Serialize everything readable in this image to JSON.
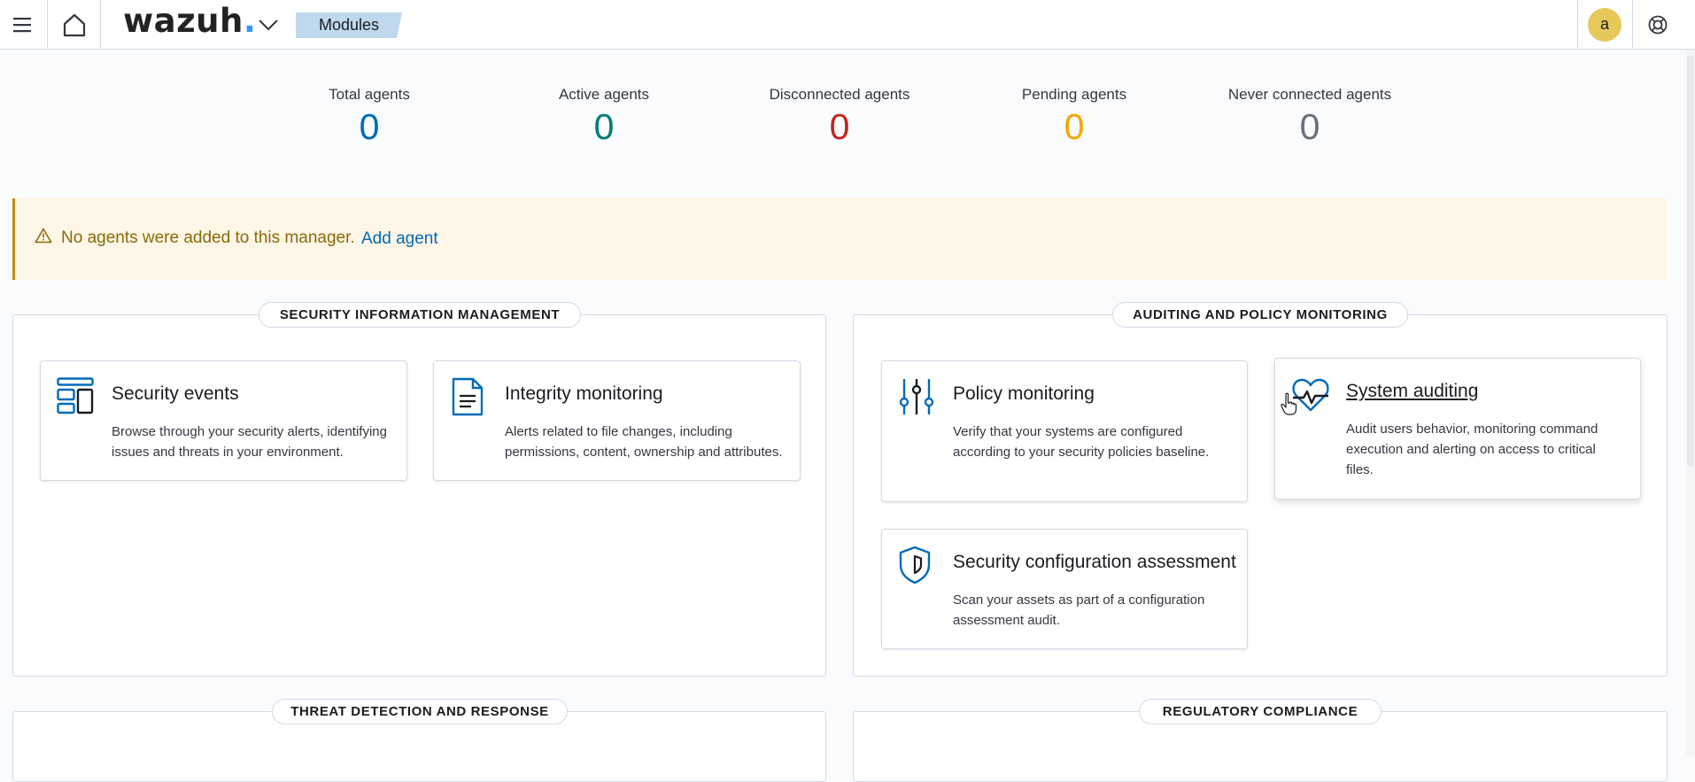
{
  "header": {
    "logo_text": "wazuh",
    "logo_dot": ".",
    "breadcrumb": "Modules",
    "user_initial": "a",
    "accent": "#3595f9"
  },
  "stats": [
    {
      "label": "Total agents",
      "value": "0",
      "color": "#006bb8"
    },
    {
      "label": "Active agents",
      "value": "0",
      "color": "#017d73"
    },
    {
      "label": "Disconnected agents",
      "value": "0",
      "color": "#bd271e"
    },
    {
      "label": "Pending agents",
      "value": "0",
      "color": "#f5a700"
    },
    {
      "label": "Never connected agents",
      "value": "0",
      "color": "#69707d"
    }
  ],
  "callout": {
    "message": "No agents were added to this manager.",
    "link": "Add agent"
  },
  "sections": {
    "sim": {
      "title": "SECURITY INFORMATION MANAGEMENT",
      "cards": [
        {
          "title": "Security events",
          "icon": "dashboard-layout-icon",
          "desc": [
            "Browse through your security alerts, identifying",
            "issues and threats in your environment."
          ]
        },
        {
          "title": "Integrity monitoring",
          "icon": "document-icon",
          "desc": [
            "Alerts related to file changes, including",
            "permissions, content, ownership and attributes."
          ]
        }
      ]
    },
    "apm": {
      "title": "AUDITING AND POLICY MONITORING",
      "cards": [
        {
          "title": "Policy monitoring",
          "icon": "sliders-icon",
          "desc": [
            "Verify that your systems are configured",
            "according to your security policies baseline."
          ]
        },
        {
          "title": "System auditing",
          "icon": "heartbeat-icon",
          "desc": [
            "Audit users behavior, monitoring command",
            "execution and alerting on access to critical",
            "files."
          ]
        },
        {
          "title": "Security configuration assessment",
          "icon": "shield-icon",
          "desc": [
            "Scan your assets as part of a configuration",
            "assessment audit."
          ]
        }
      ]
    },
    "tdr": {
      "title": "THREAT DETECTION AND RESPONSE"
    },
    "rc": {
      "title": "REGULATORY COMPLIANCE"
    }
  }
}
